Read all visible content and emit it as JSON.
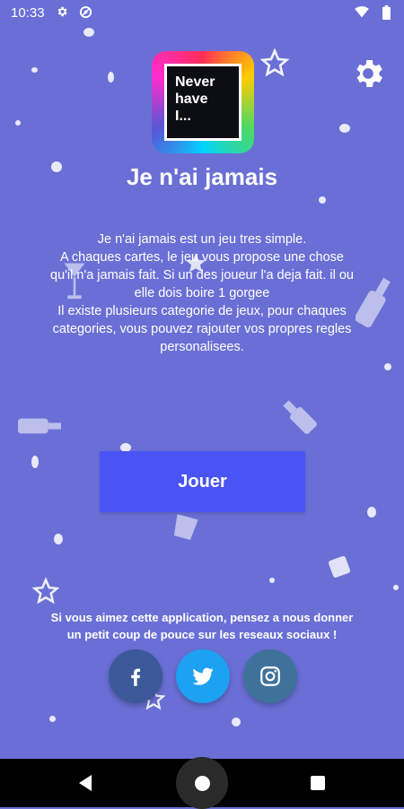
{
  "status_bar": {
    "time": "10:33",
    "icons": [
      "gear-icon",
      "vpn-icon",
      "wifi-icon",
      "battery-icon"
    ]
  },
  "logo": {
    "text": "Never\nhave\nI..."
  },
  "title": "Je n'ai jamais",
  "description": [
    "Je n'ai jamais est un jeu tres simple.",
    "A chaques cartes, le jeu vous propose une chose",
    "qu'il n'a jamais fait. Si un des joueur l'a deja fait. il ou",
    "elle dois boire 1 gorgee",
    "Il existe plusieurs categorie de jeux, pour chaques",
    "categories, vous pouvez rajouter vos propres regles",
    "personalisees."
  ],
  "play_button": "Jouer",
  "support_text": [
    "Si vous aimez cette application, pensez a nous donner",
    "un petit coup de pouce sur les reseaux sociaux !"
  ],
  "social": [
    {
      "name": "facebook",
      "icon": "facebook-icon",
      "color": "#3b5998"
    },
    {
      "name": "twitter",
      "icon": "twitter-icon",
      "color": "#1da1f2"
    },
    {
      "name": "instagram",
      "icon": "instagram-icon",
      "color": "#3f729b"
    }
  ],
  "colors": {
    "background": "#6a6fd6",
    "button": "#4a54f5",
    "navbar": "#000000"
  }
}
